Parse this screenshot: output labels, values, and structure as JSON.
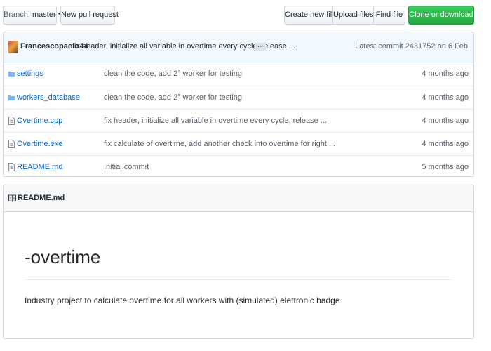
{
  "toolbar": {
    "branch_prefix": "Branch:",
    "branch_name": "master",
    "new_pull_request": "New pull request",
    "create_new_file": "Create new file",
    "upload_files": "Upload files",
    "find_file": "Find file",
    "clone_or_download": "Clone or download"
  },
  "commit": {
    "author": "Francescopaolo44",
    "message": "fix header, initialize all variable in overtime every cycle, release ...",
    "ellipsis": "...",
    "latest": "Latest commit 2431752 on 6 Feb"
  },
  "files": [
    {
      "type": "folder-icon",
      "name": "settings",
      "message": "clean the code, add 2° worker for testing",
      "age": "4 months ago"
    },
    {
      "type": "folder-icon",
      "name": "workers_database",
      "message": "clean the code, add 2° worker for testing",
      "age": "4 months ago"
    },
    {
      "type": "file-icon",
      "name": "Overtime.cpp",
      "message": "fix header, initialize all variable in overtime every cycle, release ...",
      "age": "4 months ago"
    },
    {
      "type": "file-icon",
      "name": "Overtime.exe",
      "message": "fix calculate of overtime, add another check into overtime for right ...",
      "age": "4 months ago"
    },
    {
      "type": "file-icon",
      "name": "README.md",
      "message": "Initial commit",
      "age": "5 months ago"
    }
  ],
  "readme": {
    "header": "README.md",
    "title": "-overtime",
    "description": "Industry project to calculate overtime for all workers with (simulated) elettronic badge"
  },
  "colors": {
    "link": "#0366d6",
    "folder": "#79b8ff",
    "green": "#28a745"
  }
}
